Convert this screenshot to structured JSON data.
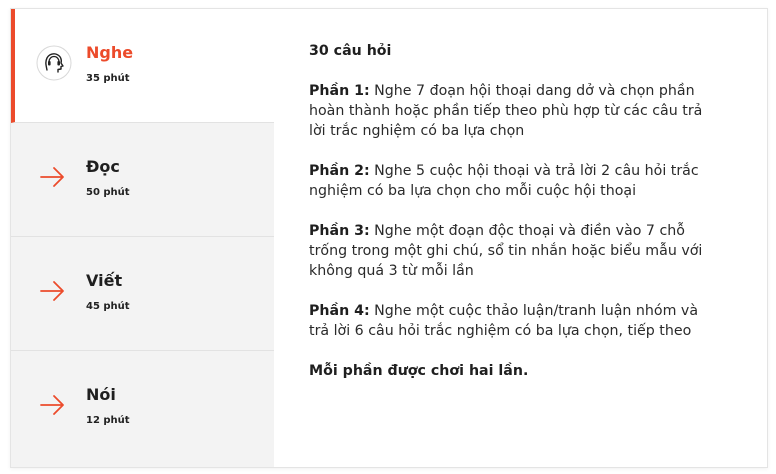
{
  "tabs": [
    {
      "title": "Nghe",
      "duration": "35 phút",
      "icon": "listening-head-icon",
      "active": true
    },
    {
      "title": "Đọc",
      "duration": "50 phút",
      "icon": "arrow-right-icon",
      "active": false
    },
    {
      "title": "Viết",
      "duration": "45 phút",
      "icon": "arrow-right-icon",
      "active": false
    },
    {
      "title": "Nói",
      "duration": "12 phút",
      "icon": "arrow-right-icon",
      "active": false
    }
  ],
  "content": {
    "heading": "30 câu hỏi",
    "parts": [
      {
        "label": "Phần 1:",
        "text": " Nghe 7 đoạn hội thoại dang dở và chọn phần hoàn thành hoặc phần tiếp theo phù hợp từ các câu trả lời trắc nghiệm có ba lựa chọn"
      },
      {
        "label": "Phần 2:",
        "text": " Nghe 5 cuộc hội thoại và trả lời 2 câu hỏi trắc nghiệm có ba lựa chọn cho mỗi cuộc hội thoại"
      },
      {
        "label": "Phần 3:",
        "text": " Nghe một đoạn độc thoại và điền vào 7 chỗ trống trong một ghi chú, sổ tin nhắn hoặc biểu mẫu với không quá 3 từ mỗi lần"
      },
      {
        "label": "Phần 4:",
        "text": " Nghe một cuộc thảo luận/tranh luận nhóm và trả lời 6 câu hỏi trắc nghiệm có ba lựa chọn, tiếp theo"
      }
    ],
    "footer": "Mỗi phần được chơi hai lần."
  },
  "colors": {
    "accent": "#ec4b2b",
    "sidebar_bg": "#f3f3f3"
  }
}
